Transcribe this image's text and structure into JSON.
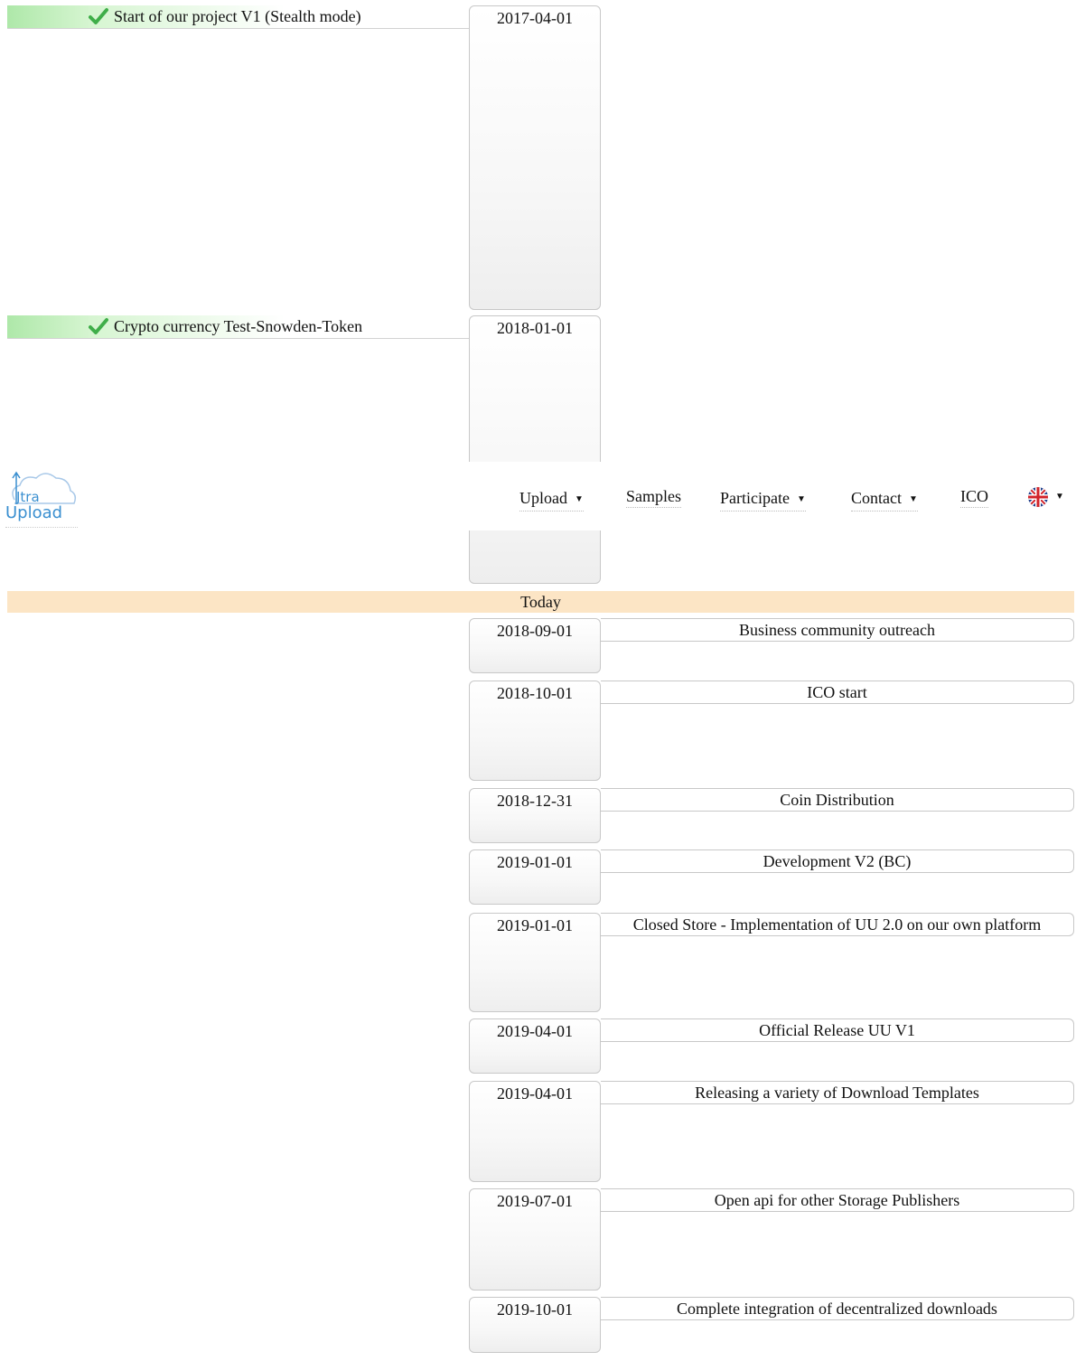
{
  "past": [
    {
      "label": "Start of our project V1 (Stealth mode)",
      "date": "2017-04-01",
      "icon": "check-icon"
    },
    {
      "label": "Crypto currency Test-Snowden-Token",
      "date": "2018-01-01",
      "icon": "check-icon"
    }
  ],
  "nav": {
    "logo_text_1": "Jtra",
    "logo_text_2": "Upload",
    "items": [
      {
        "label": "Upload",
        "dropdown": true
      },
      {
        "label": "Samples",
        "dropdown": false
      },
      {
        "label": "Participate",
        "dropdown": true
      },
      {
        "label": "Contact",
        "dropdown": true
      },
      {
        "label": "ICO",
        "dropdown": false
      }
    ],
    "language_icon": "uk-flag-icon",
    "caret_glyph": "▼"
  },
  "today_label": "Today",
  "future": [
    {
      "date": "2018-09-01",
      "label": "Business community outreach"
    },
    {
      "date": "2018-10-01",
      "label": "ICO start"
    },
    {
      "date": "2018-12-31",
      "label": "Coin Distribution"
    },
    {
      "date": "2019-01-01",
      "label": "Development V2 (BC)"
    },
    {
      "date": "2019-01-01",
      "label": "Closed Store - Implementation of UU 2.0 on our own platform"
    },
    {
      "date": "2019-04-01",
      "label": "Official Release UU V1"
    },
    {
      "date": "2019-04-01",
      "label": "Releasing a variety of Download Templates"
    },
    {
      "date": "2019-07-01",
      "label": "Open api for other Storage Publishers"
    },
    {
      "date": "2019-10-01",
      "label": "Complete integration of decentralized downloads"
    }
  ],
  "colors": {
    "past_bar": "#aee8a9",
    "today_bar": "#fce5c5",
    "logo_blue": "#3a8fd0",
    "check_green": "#3fae49"
  }
}
